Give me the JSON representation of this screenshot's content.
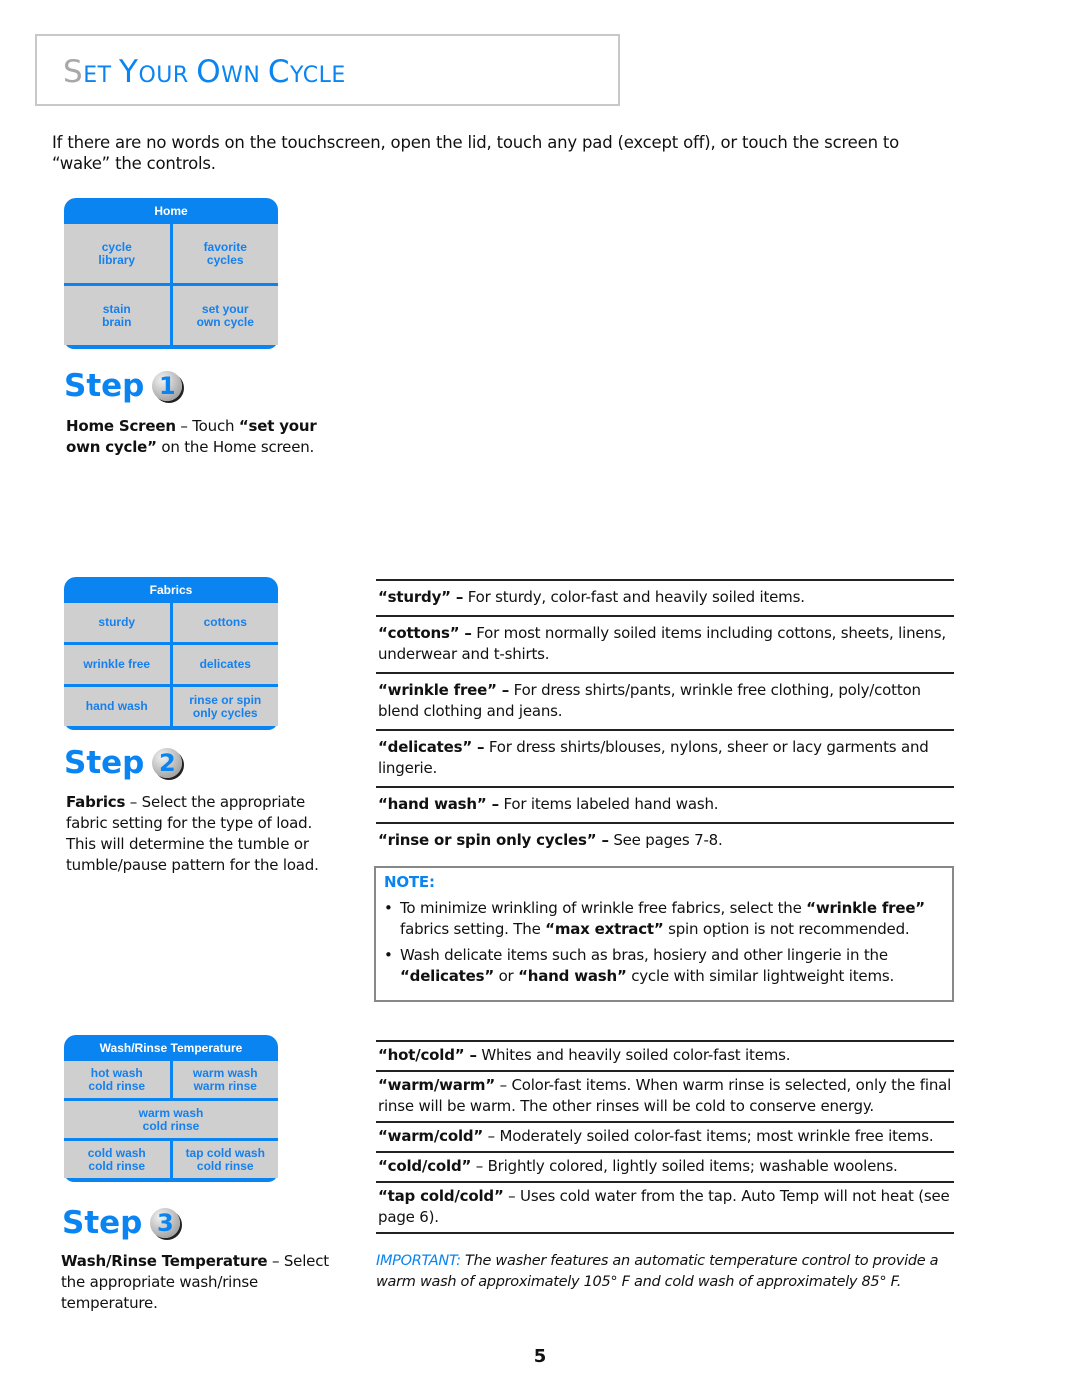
{
  "title": {
    "first_letter": "S",
    "rest_word1": "ET",
    "word2_cap": "Y",
    "word2_rest": "OUR",
    "word3_cap": "O",
    "word3_rest": "WN",
    "word4_cap": "C",
    "word4_rest": "YCLE",
    "full": "Set Your Own Cycle"
  },
  "intro": "If there are no words on the touchscreen, open the lid, touch any pad (except off), or touch the screen to “wake” the controls.",
  "home_panel": {
    "header": "Home",
    "buttons": [
      {
        "line1": "cycle",
        "line2": "library"
      },
      {
        "line1": "favorite",
        "line2": "cycles"
      },
      {
        "line1": "stain",
        "line2": "brain"
      },
      {
        "line1": "set your",
        "line2": "own cycle"
      }
    ]
  },
  "steps": [
    {
      "label": "Step",
      "number": "1",
      "bold": "Home Screen",
      "text_a": " – Touch ",
      "bold2": "“set your own cycle”",
      "text_b": " on the Home screen."
    },
    {
      "label": "Step",
      "number": "2",
      "bold": "Fabrics",
      "text_a": " – Select the appropriate fabric setting for the type of load. This will determine the tumble or tumble/pause pattern for the load."
    },
    {
      "label": "Step",
      "number": "3",
      "bold": "Wash/Rinse Temperature",
      "text_a": " – Select the appropriate wash/rinse temperature."
    }
  ],
  "fabrics_panel": {
    "header": "Fabrics",
    "buttons": [
      {
        "line1": "sturdy",
        "line2": ""
      },
      {
        "line1": "cottons",
        "line2": ""
      },
      {
        "line1": "wrinkle free",
        "line2": ""
      },
      {
        "line1": "delicates",
        "line2": ""
      },
      {
        "line1": "hand wash",
        "line2": ""
      },
      {
        "line1": "rinse or spin",
        "line2": "only cycles"
      }
    ]
  },
  "fabric_definitions": [
    {
      "term": "“sturdy” –",
      "desc": " For sturdy, color-fast and heavily soiled items."
    },
    {
      "term": "“cottons” –",
      "desc": " For most normally soiled items including cottons, sheets, linens, underwear and t-shirts."
    },
    {
      "term": "“wrinkle free” –",
      "desc": " For dress shirts/pants, wrinkle free clothing, poly/cotton blend clothing and jeans."
    },
    {
      "term": "“delicates” –",
      "desc": " For dress shirts/blouses, nylons, sheer or lacy garments and lingerie."
    },
    {
      "term": "“hand wash” –",
      "desc": " For items labeled hand wash."
    },
    {
      "term": "“rinse or spin only cycles” –",
      "desc": " See pages 7-8."
    }
  ],
  "note": {
    "title": "NOTE:",
    "items": [
      {
        "a": "To minimize wrinkling of wrinkle free fabrics, select the ",
        "b1": "“wrinkle free”",
        "c": " fabrics setting. The ",
        "b2": "“max extract”",
        "d": " spin option is not recommended."
      },
      {
        "a": "Wash delicate items such as bras, hosiery and other lingerie in the ",
        "b1": "“delicates”",
        "c": " or ",
        "b2": "“hand wash”",
        "d": " cycle with similar lightweight items."
      }
    ]
  },
  "temp_panel": {
    "header": "Wash/Rinse Temperature",
    "buttons": [
      {
        "line1": "hot wash",
        "line2": "cold rinse"
      },
      {
        "line1": "warm wash",
        "line2": "warm rinse"
      },
      {
        "line1": "warm wash",
        "line2": "cold rinse"
      },
      {
        "line1": "cold wash",
        "line2": "cold rinse"
      },
      {
        "line1": "tap cold wash",
        "line2": "cold rinse"
      }
    ]
  },
  "temp_definitions": [
    {
      "term": "“hot/cold” –",
      "desc": "  Whites and heavily soiled color-fast items."
    },
    {
      "term": "“warm/warm”",
      "desc": " – Color-fast items. When warm rinse is selected, only the final rinse will be warm. The other rinses will be cold to conserve energy."
    },
    {
      "term": "“warm/cold”",
      "desc": " – Moderately soiled color-fast items; most wrinkle free items."
    },
    {
      "term": "“cold/cold”",
      "desc": " – Brightly colored, lightly soiled items; washable woolens."
    },
    {
      "term": "“tap cold/cold”",
      "desc": " – Uses cold water from the tap.  Auto Temp will not heat (see page 6)."
    }
  ],
  "important": {
    "label": "IMPORTANT:",
    "text": " The washer features an automatic temperature control to provide a warm wash of approximately 105° F and cold wash of approximately 85° F."
  },
  "page_number": "5",
  "colors": {
    "accent": "#0a84f0",
    "panel_cell": "#cfcfcf",
    "title_first_letter": "#a8a8a8"
  }
}
